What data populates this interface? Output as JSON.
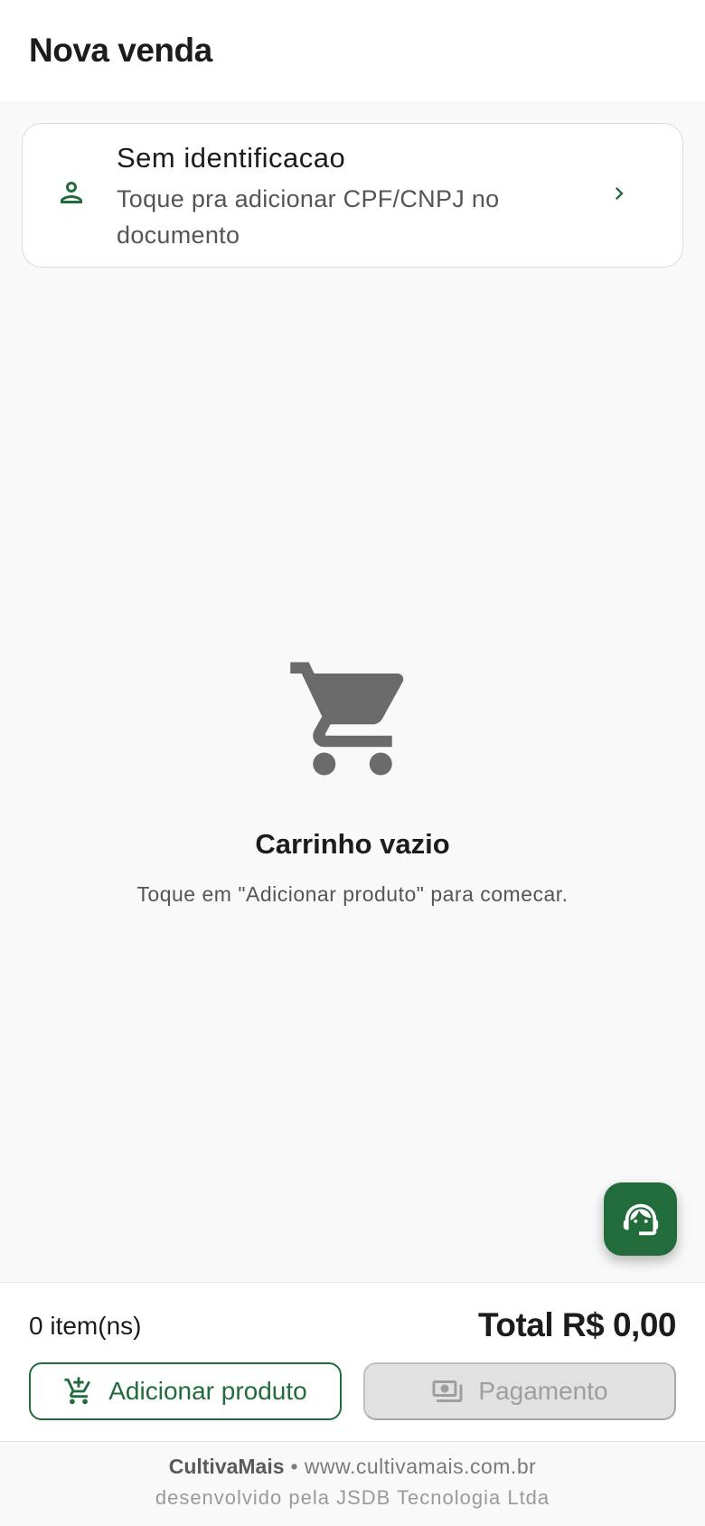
{
  "header": {
    "title": "Nova venda"
  },
  "customer": {
    "title": "Sem identificacao",
    "subtitle": "Toque pra adicionar CPF/CNPJ no documento",
    "icon": "person-icon",
    "action_icon": "chevron-right-icon"
  },
  "empty_state": {
    "icon": "shopping-cart-icon",
    "title": "Carrinho vazio",
    "hint": "Toque em \"Adicionar produto\" para comecar."
  },
  "fab": {
    "icon": "support-agent-icon"
  },
  "summary": {
    "items_count": "0 item(ns)",
    "total": "Total R$ 0,00"
  },
  "actions": {
    "add_product": {
      "label": "Adicionar produto",
      "icon": "add-shopping-cart-icon",
      "enabled": true
    },
    "payment": {
      "label": "Pagamento",
      "icon": "payments-icon",
      "enabled": false
    }
  },
  "footer": {
    "brand": "CultivaMais",
    "separator": "•",
    "website": "www.cultivamais.com.br",
    "credit": "desenvolvido pela JSDB Tecnologia Ltda"
  },
  "colors": {
    "primary": "#226b3b",
    "background": "#f9f9f9",
    "surface": "#ffffff",
    "disabled_bg": "#e1e1e1",
    "disabled_text": "#9e9e9e",
    "muted_icon": "#6b6b6b"
  }
}
